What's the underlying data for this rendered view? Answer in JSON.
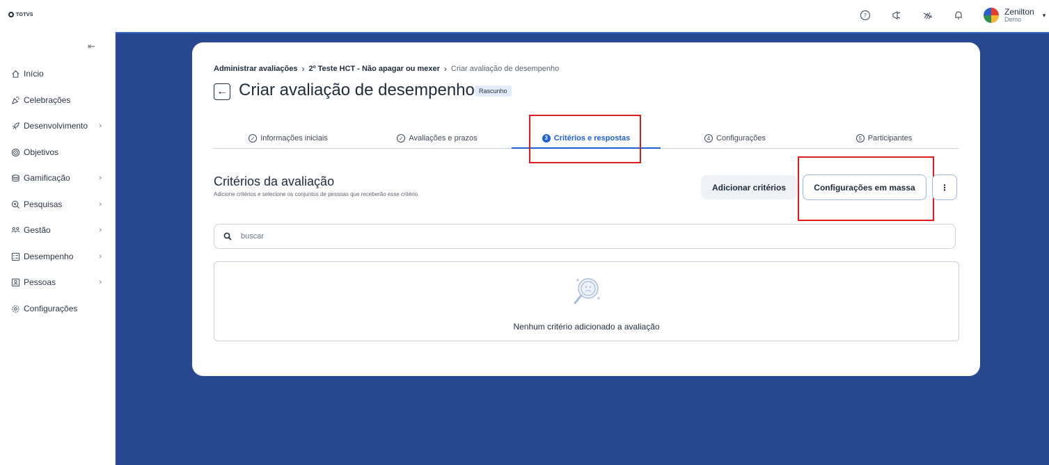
{
  "brand": {
    "logo_text": "TOTVS"
  },
  "user": {
    "name": "Zenilton",
    "subtitle": "Demo"
  },
  "sidebar": {
    "items": [
      {
        "label": "Início",
        "icon": "home-icon",
        "has_children": false
      },
      {
        "label": "Celebrações",
        "icon": "party-icon",
        "has_children": false
      },
      {
        "label": "Desenvolvimento",
        "icon": "rocket-icon",
        "has_children": true
      },
      {
        "label": "Objetivos",
        "icon": "target-icon",
        "has_children": false
      },
      {
        "label": "Gamificação",
        "icon": "coins-icon",
        "has_children": true
      },
      {
        "label": "Pesquisas",
        "icon": "survey-icon",
        "has_children": true
      },
      {
        "label": "Gestão",
        "icon": "team-icon",
        "has_children": true
      },
      {
        "label": "Desempenho",
        "icon": "checklist-icon",
        "has_children": true
      },
      {
        "label": "Pessoas",
        "icon": "person-icon",
        "has_children": true
      },
      {
        "label": "Configurações",
        "icon": "gear-icon",
        "has_children": false
      }
    ]
  },
  "breadcrumb": {
    "items": [
      "Administrar avaliações",
      "2º Teste HCT - Não apagar ou mexer",
      "Criar avaliação de desempenho"
    ]
  },
  "page": {
    "title": "Criar avaliação de desempenho",
    "status": "Rascunho"
  },
  "tabs": [
    {
      "label": "Informações iniciais",
      "marker": "✓",
      "state": "done"
    },
    {
      "label": "Avaliações e prazos",
      "marker": "✓",
      "state": "done"
    },
    {
      "label": "Critérios e respostas",
      "marker": "3",
      "state": "active"
    },
    {
      "label": "Configurações",
      "marker": "4",
      "state": "pending"
    },
    {
      "label": "Participantes",
      "marker": "5",
      "state": "pending"
    }
  ],
  "section": {
    "title": "Critérios da avaliação",
    "subtitle": "Adicione critérios e selecione os conjuntos de pessoas que receberão esse critério.",
    "add_button": "Adicionar critérios",
    "mass_button": "Configurações em massa"
  },
  "search": {
    "placeholder": "buscar"
  },
  "empty_state": {
    "message": "Nenhum critério adicionado a avaliação"
  },
  "colors": {
    "accent": "#1d5fd6",
    "background": "#284991",
    "highlight": "#e4191b"
  }
}
